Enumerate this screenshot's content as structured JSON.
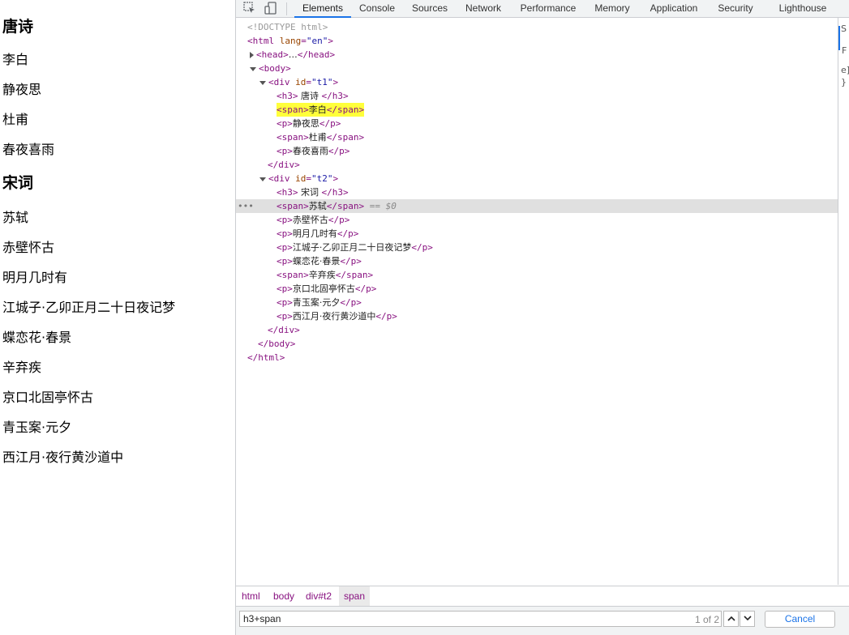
{
  "page": {
    "sections": [
      {
        "title": "唐诗",
        "items": [
          "李白",
          "静夜思",
          "杜甫",
          "春夜喜雨"
        ]
      },
      {
        "title": "宋词",
        "items": [
          "苏轼",
          "赤壁怀古",
          "明月几时有",
          "江城子·乙卯正月二十日夜记梦",
          "蝶恋花·春景",
          "辛弃疾",
          "京口北固亭怀古",
          "青玉案·元夕",
          "西江月·夜行黄沙道中"
        ]
      }
    ]
  },
  "devtools": {
    "tabs": [
      "Elements",
      "Console",
      "Sources",
      "Network",
      "Performance",
      "Memory",
      "Application",
      "Security",
      "Lighthouse"
    ],
    "active_tab": "Elements",
    "icons": [
      "inspect-element-icon",
      "device-toolbar-icon"
    ],
    "tree": {
      "doctype": "<!DOCTYPE html>",
      "html_open": "<html",
      "html_attr": "lang",
      "html_val": "\"en\"",
      "head_tag": "<head>",
      "head_ellipsis": "…",
      "head_close": "</head>",
      "body_open": "<body>",
      "div1_open": "<div",
      "div_attr": "id",
      "div1_val": "\"t1\"",
      "div2_val": "\"t2\"",
      "tag_gt": ">",
      "selected_marker": "== $0",
      "div_close": "</div>",
      "body_close": "</body>",
      "html_close": "</html>",
      "t1_children": [
        {
          "tag": "h3",
          "text": " 唐诗 "
        },
        {
          "tag": "span",
          "text": "李白",
          "highlighted": true
        },
        {
          "tag": "p",
          "text": "静夜思"
        },
        {
          "tag": "span",
          "text": "杜甫"
        },
        {
          "tag": "p",
          "text": "春夜喜雨"
        }
      ],
      "t2_children": [
        {
          "tag": "h3",
          "text": " 宋词 "
        },
        {
          "tag": "span",
          "text": "苏轼",
          "selected": true
        },
        {
          "tag": "p",
          "text": "赤壁怀古"
        },
        {
          "tag": "p",
          "text": "明月几时有"
        },
        {
          "tag": "p",
          "text": "江城子·乙卯正月二十日夜记梦"
        },
        {
          "tag": "p",
          "text": "蝶恋花·春景"
        },
        {
          "tag": "span",
          "text": "辛弃疾"
        },
        {
          "tag": "p",
          "text": "京口北固亭怀古"
        },
        {
          "tag": "p",
          "text": "青玉案·元夕"
        },
        {
          "tag": "p",
          "text": "西江月·夜行黄沙道中"
        }
      ]
    },
    "styles_pane_fragments": [
      "S",
      "F",
      "e]",
      "}"
    ],
    "breadcrumbs": [
      "html",
      "body",
      "div#t2",
      "span"
    ],
    "active_breadcrumb": "span",
    "search": {
      "value": "h3+span",
      "match_count": "1 of 2",
      "cancel_label": "Cancel"
    },
    "colors": {
      "accent": "#1a73e8",
      "tag": "#881280",
      "attr": "#994500",
      "attr_value": "#1a1aa6",
      "highlight": "#ffff3b",
      "selected_row": "#e0e0e0"
    }
  }
}
